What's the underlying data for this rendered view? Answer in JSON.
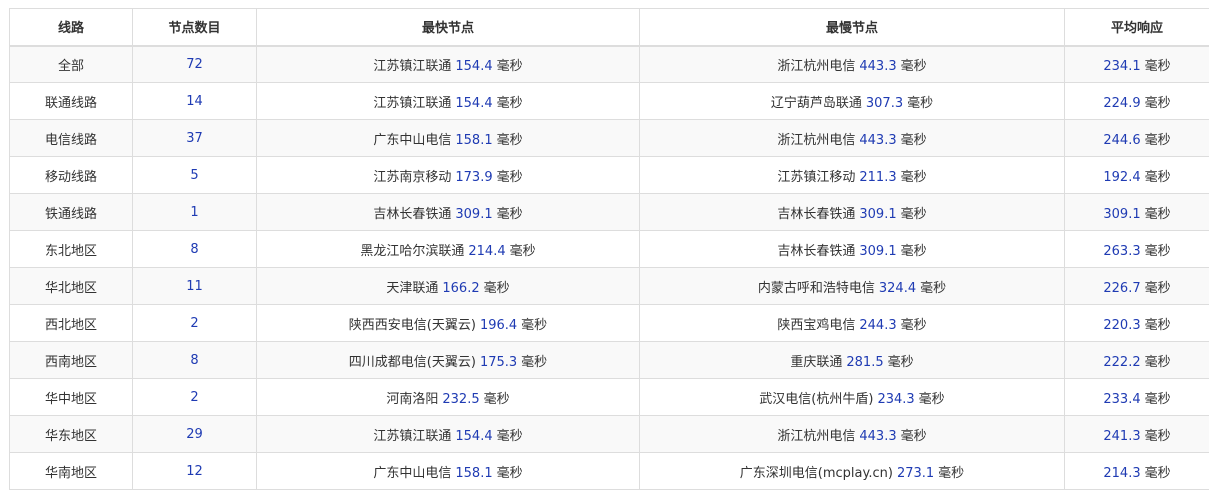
{
  "headers": [
    "线路",
    "节点数目",
    "最快节点",
    "最慢节点",
    "平均响应"
  ],
  "unit": "毫秒",
  "rows": [
    {
      "line": "全部",
      "count": "72",
      "fast_name": "江苏镇江联通",
      "fast_ms": "154.4",
      "slow_name": "浙江杭州电信",
      "slow_ms": "443.3",
      "avg_ms": "234.1"
    },
    {
      "line": "联通线路",
      "count": "14",
      "fast_name": "江苏镇江联通",
      "fast_ms": "154.4",
      "slow_name": "辽宁葫芦岛联通",
      "slow_ms": "307.3",
      "avg_ms": "224.9"
    },
    {
      "line": "电信线路",
      "count": "37",
      "fast_name": "广东中山电信",
      "fast_ms": "158.1",
      "slow_name": "浙江杭州电信",
      "slow_ms": "443.3",
      "avg_ms": "244.6"
    },
    {
      "line": "移动线路",
      "count": "5",
      "fast_name": "江苏南京移动",
      "fast_ms": "173.9",
      "slow_name": "江苏镇江移动",
      "slow_ms": "211.3",
      "avg_ms": "192.4"
    },
    {
      "line": "铁通线路",
      "count": "1",
      "fast_name": "吉林长春铁通",
      "fast_ms": "309.1",
      "slow_name": "吉林长春铁通",
      "slow_ms": "309.1",
      "avg_ms": "309.1"
    },
    {
      "line": "东北地区",
      "count": "8",
      "fast_name": "黑龙江哈尔滨联通",
      "fast_ms": "214.4",
      "slow_name": "吉林长春铁通",
      "slow_ms": "309.1",
      "avg_ms": "263.3"
    },
    {
      "line": "华北地区",
      "count": "11",
      "fast_name": "天津联通",
      "fast_ms": "166.2",
      "slow_name": "内蒙古呼和浩特电信",
      "slow_ms": "324.4",
      "avg_ms": "226.7"
    },
    {
      "line": "西北地区",
      "count": "2",
      "fast_name": "陕西西安电信(天翼云)",
      "fast_ms": "196.4",
      "slow_name": "陕西宝鸡电信",
      "slow_ms": "244.3",
      "avg_ms": "220.3"
    },
    {
      "line": "西南地区",
      "count": "8",
      "fast_name": "四川成都电信(天翼云)",
      "fast_ms": "175.3",
      "slow_name": "重庆联通",
      "slow_ms": "281.5",
      "avg_ms": "222.2"
    },
    {
      "line": "华中地区",
      "count": "2",
      "fast_name": "河南洛阳",
      "fast_ms": "232.5",
      "slow_name": "武汉电信(杭州牛盾)",
      "slow_ms": "234.3",
      "avg_ms": "233.4"
    },
    {
      "line": "华东地区",
      "count": "29",
      "fast_name": "江苏镇江联通",
      "fast_ms": "154.4",
      "slow_name": "浙江杭州电信",
      "slow_ms": "443.3",
      "avg_ms": "241.3"
    },
    {
      "line": "华南地区",
      "count": "12",
      "fast_name": "广东中山电信",
      "fast_ms": "158.1",
      "slow_name": "广东深圳电信(mcplay.cn)",
      "slow_ms": "273.1",
      "avg_ms": "214.3"
    }
  ],
  "colors": {
    "number": "#1f3bb3",
    "text": "#333333",
    "border": "#dddddd",
    "stripe": "#f9f9f9"
  }
}
